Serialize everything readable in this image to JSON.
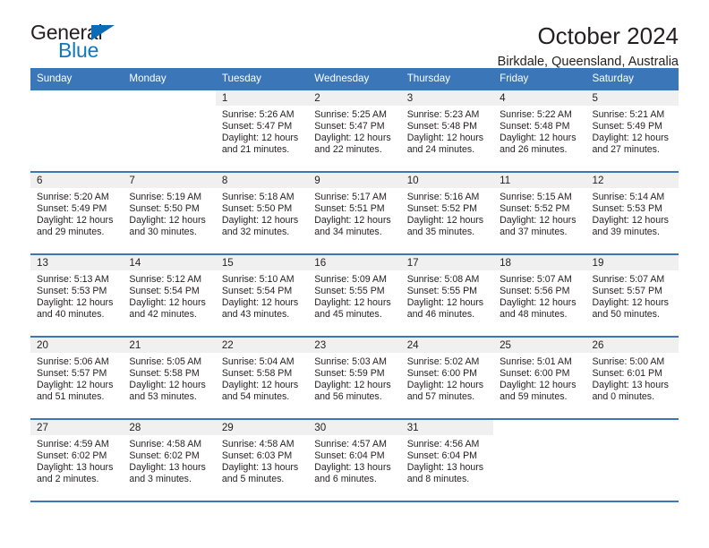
{
  "brand": {
    "name_top": "General",
    "name_bottom": "Blue",
    "triangle_icon": "triangle-icon",
    "color_dark": "#231f20",
    "color_blue": "#1278be"
  },
  "header": {
    "title": "October 2024",
    "location": "Birkdale, Queensland, Australia"
  },
  "theme": {
    "header_blue": "#3b77b8",
    "cell_band_gray": "#f0f0f0",
    "text": "#231f20"
  },
  "calendar": {
    "weekday_headers": [
      "Sunday",
      "Monday",
      "Tuesday",
      "Wednesday",
      "Thursday",
      "Friday",
      "Saturday"
    ],
    "labels": {
      "sunrise": "Sunrise:",
      "sunset": "Sunset:",
      "daylight": "Daylight:"
    },
    "weeks": [
      [
        {
          "day": ""
        },
        {
          "day": ""
        },
        {
          "day": "1",
          "sunrise": "Sunrise: 5:26 AM",
          "sunset": "Sunset: 5:47 PM",
          "daylight_1": "Daylight: 12 hours",
          "daylight_2": "and 21 minutes."
        },
        {
          "day": "2",
          "sunrise": "Sunrise: 5:25 AM",
          "sunset": "Sunset: 5:47 PM",
          "daylight_1": "Daylight: 12 hours",
          "daylight_2": "and 22 minutes."
        },
        {
          "day": "3",
          "sunrise": "Sunrise: 5:23 AM",
          "sunset": "Sunset: 5:48 PM",
          "daylight_1": "Daylight: 12 hours",
          "daylight_2": "and 24 minutes."
        },
        {
          "day": "4",
          "sunrise": "Sunrise: 5:22 AM",
          "sunset": "Sunset: 5:48 PM",
          "daylight_1": "Daylight: 12 hours",
          "daylight_2": "and 26 minutes."
        },
        {
          "day": "5",
          "sunrise": "Sunrise: 5:21 AM",
          "sunset": "Sunset: 5:49 PM",
          "daylight_1": "Daylight: 12 hours",
          "daylight_2": "and 27 minutes."
        }
      ],
      [
        {
          "day": "6",
          "sunrise": "Sunrise: 5:20 AM",
          "sunset": "Sunset: 5:49 PM",
          "daylight_1": "Daylight: 12 hours",
          "daylight_2": "and 29 minutes."
        },
        {
          "day": "7",
          "sunrise": "Sunrise: 5:19 AM",
          "sunset": "Sunset: 5:50 PM",
          "daylight_1": "Daylight: 12 hours",
          "daylight_2": "and 30 minutes."
        },
        {
          "day": "8",
          "sunrise": "Sunrise: 5:18 AM",
          "sunset": "Sunset: 5:50 PM",
          "daylight_1": "Daylight: 12 hours",
          "daylight_2": "and 32 minutes."
        },
        {
          "day": "9",
          "sunrise": "Sunrise: 5:17 AM",
          "sunset": "Sunset: 5:51 PM",
          "daylight_1": "Daylight: 12 hours",
          "daylight_2": "and 34 minutes."
        },
        {
          "day": "10",
          "sunrise": "Sunrise: 5:16 AM",
          "sunset": "Sunset: 5:52 PM",
          "daylight_1": "Daylight: 12 hours",
          "daylight_2": "and 35 minutes."
        },
        {
          "day": "11",
          "sunrise": "Sunrise: 5:15 AM",
          "sunset": "Sunset: 5:52 PM",
          "daylight_1": "Daylight: 12 hours",
          "daylight_2": "and 37 minutes."
        },
        {
          "day": "12",
          "sunrise": "Sunrise: 5:14 AM",
          "sunset": "Sunset: 5:53 PM",
          "daylight_1": "Daylight: 12 hours",
          "daylight_2": "and 39 minutes."
        }
      ],
      [
        {
          "day": "13",
          "sunrise": "Sunrise: 5:13 AM",
          "sunset": "Sunset: 5:53 PM",
          "daylight_1": "Daylight: 12 hours",
          "daylight_2": "and 40 minutes."
        },
        {
          "day": "14",
          "sunrise": "Sunrise: 5:12 AM",
          "sunset": "Sunset: 5:54 PM",
          "daylight_1": "Daylight: 12 hours",
          "daylight_2": "and 42 minutes."
        },
        {
          "day": "15",
          "sunrise": "Sunrise: 5:10 AM",
          "sunset": "Sunset: 5:54 PM",
          "daylight_1": "Daylight: 12 hours",
          "daylight_2": "and 43 minutes."
        },
        {
          "day": "16",
          "sunrise": "Sunrise: 5:09 AM",
          "sunset": "Sunset: 5:55 PM",
          "daylight_1": "Daylight: 12 hours",
          "daylight_2": "and 45 minutes."
        },
        {
          "day": "17",
          "sunrise": "Sunrise: 5:08 AM",
          "sunset": "Sunset: 5:55 PM",
          "daylight_1": "Daylight: 12 hours",
          "daylight_2": "and 46 minutes."
        },
        {
          "day": "18",
          "sunrise": "Sunrise: 5:07 AM",
          "sunset": "Sunset: 5:56 PM",
          "daylight_1": "Daylight: 12 hours",
          "daylight_2": "and 48 minutes."
        },
        {
          "day": "19",
          "sunrise": "Sunrise: 5:07 AM",
          "sunset": "Sunset: 5:57 PM",
          "daylight_1": "Daylight: 12 hours",
          "daylight_2": "and 50 minutes."
        }
      ],
      [
        {
          "day": "20",
          "sunrise": "Sunrise: 5:06 AM",
          "sunset": "Sunset: 5:57 PM",
          "daylight_1": "Daylight: 12 hours",
          "daylight_2": "and 51 minutes."
        },
        {
          "day": "21",
          "sunrise": "Sunrise: 5:05 AM",
          "sunset": "Sunset: 5:58 PM",
          "daylight_1": "Daylight: 12 hours",
          "daylight_2": "and 53 minutes."
        },
        {
          "day": "22",
          "sunrise": "Sunrise: 5:04 AM",
          "sunset": "Sunset: 5:58 PM",
          "daylight_1": "Daylight: 12 hours",
          "daylight_2": "and 54 minutes."
        },
        {
          "day": "23",
          "sunrise": "Sunrise: 5:03 AM",
          "sunset": "Sunset: 5:59 PM",
          "daylight_1": "Daylight: 12 hours",
          "daylight_2": "and 56 minutes."
        },
        {
          "day": "24",
          "sunrise": "Sunrise: 5:02 AM",
          "sunset": "Sunset: 6:00 PM",
          "daylight_1": "Daylight: 12 hours",
          "daylight_2": "and 57 minutes."
        },
        {
          "day": "25",
          "sunrise": "Sunrise: 5:01 AM",
          "sunset": "Sunset: 6:00 PM",
          "daylight_1": "Daylight: 12 hours",
          "daylight_2": "and 59 minutes."
        },
        {
          "day": "26",
          "sunrise": "Sunrise: 5:00 AM",
          "sunset": "Sunset: 6:01 PM",
          "daylight_1": "Daylight: 13 hours",
          "daylight_2": "and 0 minutes."
        }
      ],
      [
        {
          "day": "27",
          "sunrise": "Sunrise: 4:59 AM",
          "sunset": "Sunset: 6:02 PM",
          "daylight_1": "Daylight: 13 hours",
          "daylight_2": "and 2 minutes."
        },
        {
          "day": "28",
          "sunrise": "Sunrise: 4:58 AM",
          "sunset": "Sunset: 6:02 PM",
          "daylight_1": "Daylight: 13 hours",
          "daylight_2": "and 3 minutes."
        },
        {
          "day": "29",
          "sunrise": "Sunrise: 4:58 AM",
          "sunset": "Sunset: 6:03 PM",
          "daylight_1": "Daylight: 13 hours",
          "daylight_2": "and 5 minutes."
        },
        {
          "day": "30",
          "sunrise": "Sunrise: 4:57 AM",
          "sunset": "Sunset: 6:04 PM",
          "daylight_1": "Daylight: 13 hours",
          "daylight_2": "and 6 minutes."
        },
        {
          "day": "31",
          "sunrise": "Sunrise: 4:56 AM",
          "sunset": "Sunset: 6:04 PM",
          "daylight_1": "Daylight: 13 hours",
          "daylight_2": "and 8 minutes."
        },
        {
          "day": ""
        },
        {
          "day": ""
        }
      ]
    ]
  }
}
